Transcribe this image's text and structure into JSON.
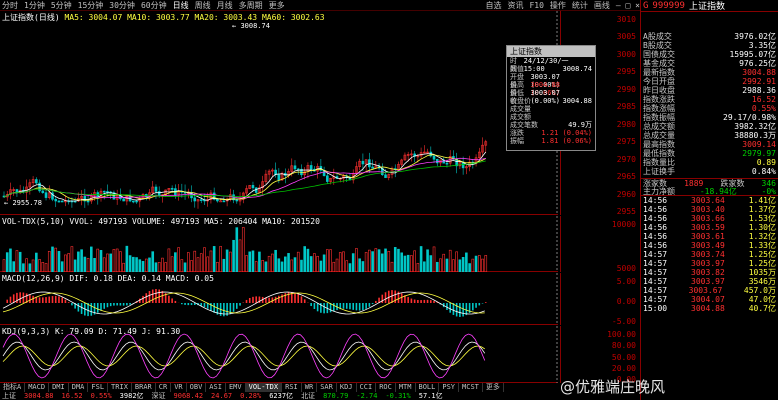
{
  "toolbar": {
    "items": [
      "分时",
      "1分钟",
      "5分钟",
      "15分钟",
      "30分钟",
      "60分钟",
      "日线",
      "周线",
      "月线",
      "多周期",
      "更多"
    ],
    "active_index": 6,
    "right_items": [
      "自选",
      "资讯",
      "F10",
      "操作",
      "统计",
      "画线"
    ]
  },
  "window_controls": "— □ ×",
  "main_panel": {
    "title": "上证指数(日线)",
    "ma_text": "MA5: 3004.07  MA10: 3003.77  MA20: 3003.43  MA60: 3002.63",
    "peak_label": "3008.74",
    "low_label": "2955.78"
  },
  "vol_panel": {
    "title": "VOL-TDX(5,10)  VVOL: 497193  VOLUME: 497193  MA5: 206404  MA10: 201520"
  },
  "macd_panel": {
    "title": "MACD(12,26,9)  DIF: 0.18  DEA: 0.14  MACD: 0.05"
  },
  "kdj_panel": {
    "title": "KDJ(9,3,3)  K: 79.09  D: 71.49  J: 91.30"
  },
  "price_axis": [
    "3010",
    "3005",
    "3000",
    "2995",
    "2990",
    "2985",
    "2980",
    "2975",
    "2970",
    "2965",
    "2960",
    "2955"
  ],
  "vol_axis": [
    "10000",
    "5000"
  ],
  "macd_axis": [
    "5.00",
    "0.00",
    "-5.00"
  ],
  "kdj_axis": [
    "100.00",
    "80.00",
    "50.00",
    "20.00",
    "0.00"
  ],
  "x_labels": [
    "12.22",
    "01.04",
    "12.07",
    "12.14",
    "01.03",
    "10.29",
    "06.22",
    "11.03",
    "01.28",
    "03.21",
    "04.21",
    "11.08",
    "12.17"
  ],
  "popup": {
    "title": "上证指数",
    "rows": [
      {
        "k": "时间",
        "v": "24/12/30/一 15:00"
      },
      {
        "k": "数值",
        "v": "3008.74"
      },
      {
        "k": "开盘价",
        "v": "3003.07 (0.00%)"
      },
      {
        "k": "最高价",
        "v": "3004.88 (0.06%)"
      },
      {
        "k": "最低价",
        "v": "3003.07 (0.00%)"
      },
      {
        "k": "收盘价",
        "v": "3004.88"
      },
      {
        "k": "成交量",
        "v": ""
      },
      {
        "k": "成交额",
        "v": ""
      },
      {
        "k": "成交笔数",
        "v": "49.9万"
      },
      {
        "k": "涨跌",
        "v": "1.21 (0.04%)"
      },
      {
        "k": "振幅",
        "v": "1.81 (0.06%)"
      }
    ]
  },
  "info": {
    "code": "999999",
    "name": "上证指数",
    "rows_top": [
      {
        "k": "A股成交",
        "v": "3976.02亿",
        "c": "wht"
      },
      {
        "k": "B股成交",
        "v": "3.35亿",
        "c": "wht"
      },
      {
        "k": "国债成交",
        "v": "15995.07亿",
        "c": "wht"
      },
      {
        "k": "基金成交",
        "v": "976.25亿",
        "c": "wht"
      },
      {
        "k": "最新指数",
        "v": "3004.88",
        "c": "red"
      },
      {
        "k": "今日开盘",
        "v": "2992.91",
        "c": "red"
      },
      {
        "k": "昨日收盘",
        "v": "2988.36",
        "c": "wht"
      },
      {
        "k": "指数涨跌",
        "v": "16.52",
        "c": "red"
      },
      {
        "k": "指数涨幅",
        "v": "0.55%",
        "c": "red"
      },
      {
        "k": "指数振幅",
        "v": "29.17/0.98%",
        "c": "wht"
      },
      {
        "k": "总成交额",
        "v": "3982.32亿",
        "c": "wht"
      },
      {
        "k": "总成交量",
        "v": "38880.3万",
        "c": "wht"
      },
      {
        "k": "最高指数",
        "v": "3009.14",
        "c": "red"
      },
      {
        "k": "最低指数",
        "v": "2979.97",
        "c": "grn"
      },
      {
        "k": "指数量比",
        "v": "0.89",
        "c": "yel"
      },
      {
        "k": "上证换手",
        "v": "0.84%",
        "c": "wht"
      }
    ],
    "updown": {
      "up_label": "涨家数",
      "up": "1889",
      "down_label": "跌家数",
      "down": "346"
    },
    "main_flow": {
      "label": "主力净额",
      "v": "-18.94亿",
      "pct": "-0%"
    },
    "ticks": [
      {
        "t": "14:56",
        "p": "3003.64",
        "v": "1.41亿"
      },
      {
        "t": "14:56",
        "p": "3003.40",
        "v": "1.37亿"
      },
      {
        "t": "14:56",
        "p": "3003.66",
        "v": "1.53亿"
      },
      {
        "t": "14:56",
        "p": "3003.59",
        "v": "1.30亿"
      },
      {
        "t": "14:56",
        "p": "3003.61",
        "v": "1.32亿"
      },
      {
        "t": "14:56",
        "p": "3003.49",
        "v": "1.33亿"
      },
      {
        "t": "14:57",
        "p": "3003.74",
        "v": "1.25亿"
      },
      {
        "t": "14:57",
        "p": "3003.97",
        "v": "1.25亿"
      },
      {
        "t": "14:57",
        "p": "3003.82",
        "v": "1035万"
      },
      {
        "t": "14:57",
        "p": "3003.97",
        "v": "3546万"
      },
      {
        "t": "14:57",
        "p": "3003.67",
        "v": "457.0万"
      },
      {
        "t": "14:57",
        "p": "3004.07",
        "v": "47.0亿"
      },
      {
        "t": "15:00",
        "p": "3004.88",
        "v": "40.7亿"
      }
    ]
  },
  "tabs": [
    "指标A",
    "MACD",
    "DMI",
    "DMA",
    "FSL",
    "TRIX",
    "BRAR",
    "CR",
    "VR",
    "OBV",
    "ASI",
    "EMV",
    "VOL-TDX",
    "RSI",
    "WR",
    "SAR",
    "KDJ",
    "CCI",
    "ROC",
    "MTM",
    "BOLL",
    "PSY",
    "MCST",
    "更多"
  ],
  "bottom_quote": [
    {
      "t": "上证",
      "c": "lab"
    },
    {
      "t": "3004.88",
      "c": "red"
    },
    {
      "t": "16.52",
      "c": "red"
    },
    {
      "t": "0.55%",
      "c": "red"
    },
    {
      "t": "3982亿",
      "c": "wht"
    },
    {
      "t": "深证",
      "c": "lab"
    },
    {
      "t": "9068.42",
      "c": "red"
    },
    {
      "t": "24.67",
      "c": "red"
    },
    {
      "t": "0.28%",
      "c": "red"
    },
    {
      "t": "6237亿",
      "c": "wht"
    },
    {
      "t": "北证",
      "c": "lab"
    },
    {
      "t": "870.79",
      "c": "grn"
    },
    {
      "t": "-2.74",
      "c": "grn"
    },
    {
      "t": "-0.31%",
      "c": "grn"
    },
    {
      "t": "57.1亿",
      "c": "wht"
    }
  ],
  "watermark": "@优雅端庄晚风",
  "colors": {
    "up": "#ff3030",
    "down": "#00c8c8",
    "ma5": "#ffffff",
    "ma10": "#ffff40",
    "ma20": "#ff40ff",
    "ma60": "#00c000",
    "grid": "#800000"
  }
}
